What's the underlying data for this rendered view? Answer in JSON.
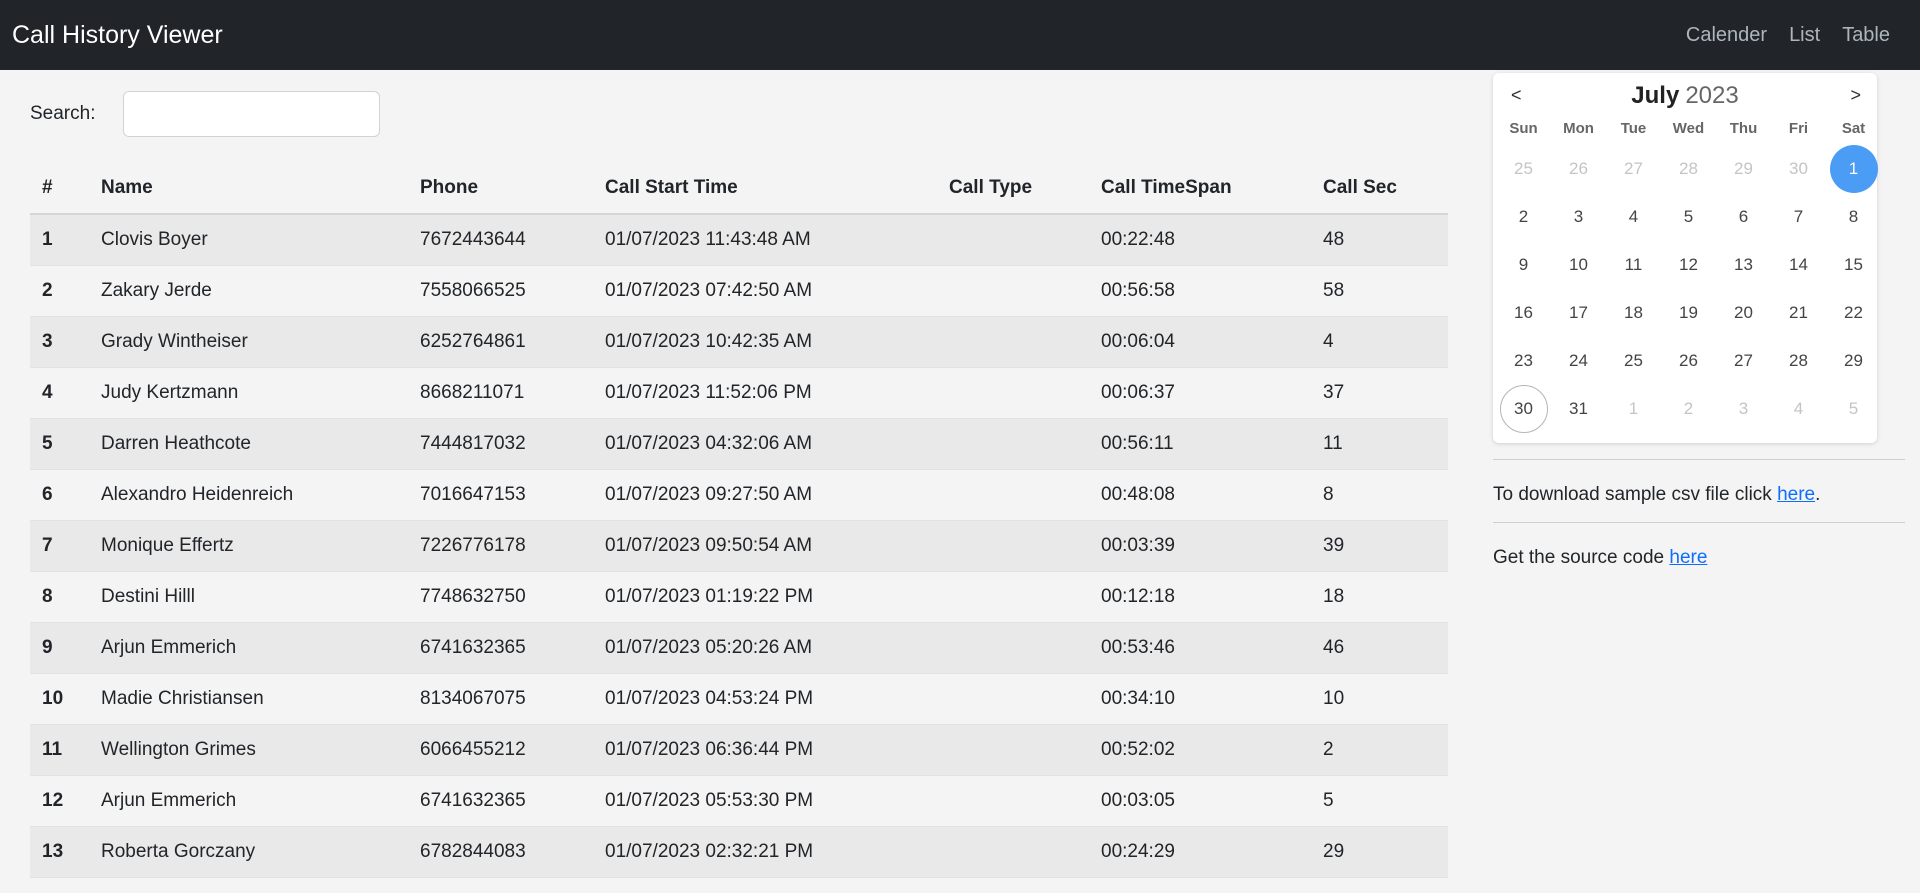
{
  "app": {
    "title": "Call History Viewer"
  },
  "nav": {
    "links": [
      "Calender",
      "List",
      "Table"
    ]
  },
  "search": {
    "label": "Search:",
    "value": ""
  },
  "table": {
    "headers": [
      "#",
      "Name",
      "Phone",
      "Call Start Time",
      "Call Type",
      "Call TimeSpan",
      "Call Sec"
    ],
    "rows": [
      [
        "1",
        "Clovis Boyer",
        "7672443644",
        "01/07/2023 11:43:48 AM",
        "",
        "00:22:48",
        "48"
      ],
      [
        "2",
        "Zakary Jerde",
        "7558066525",
        "01/07/2023 07:42:50 AM",
        "",
        "00:56:58",
        "58"
      ],
      [
        "3",
        "Grady Wintheiser",
        "6252764861",
        "01/07/2023 10:42:35 AM",
        "",
        "00:06:04",
        "4"
      ],
      [
        "4",
        "Judy Kertzmann",
        "8668211071",
        "01/07/2023 11:52:06 PM",
        "",
        "00:06:37",
        "37"
      ],
      [
        "5",
        "Darren Heathcote",
        "7444817032",
        "01/07/2023 04:32:06 AM",
        "",
        "00:56:11",
        "11"
      ],
      [
        "6",
        "Alexandro Heidenreich",
        "7016647153",
        "01/07/2023 09:27:50 AM",
        "",
        "00:48:08",
        "8"
      ],
      [
        "7",
        "Monique Effertz",
        "7226776178",
        "01/07/2023 09:50:54 AM",
        "",
        "00:03:39",
        "39"
      ],
      [
        "8",
        "Destini Hilll",
        "7748632750",
        "01/07/2023 01:19:22 PM",
        "",
        "00:12:18",
        "18"
      ],
      [
        "9",
        "Arjun Emmerich",
        "6741632365",
        "01/07/2023 05:20:26 AM",
        "",
        "00:53:46",
        "46"
      ],
      [
        "10",
        "Madie Christiansen",
        "8134067075",
        "01/07/2023 04:53:24 PM",
        "",
        "00:34:10",
        "10"
      ],
      [
        "11",
        "Wellington Grimes",
        "6066455212",
        "01/07/2023 06:36:44 PM",
        "",
        "00:52:02",
        "2"
      ],
      [
        "12",
        "Arjun Emmerich",
        "6741632365",
        "01/07/2023 05:53:30 PM",
        "",
        "00:03:05",
        "5"
      ],
      [
        "13",
        "Roberta Gorczany",
        "6782844083",
        "01/07/2023 02:32:21 PM",
        "",
        "00:24:29",
        "29"
      ]
    ]
  },
  "calendar": {
    "prev": "<",
    "next": ">",
    "month": "July",
    "year": "2023",
    "weekdays": [
      "Sun",
      "Mon",
      "Tue",
      "Wed",
      "Thu",
      "Fri",
      "Sat"
    ],
    "days": [
      {
        "label": "25",
        "muted": true
      },
      {
        "label": "26",
        "muted": true
      },
      {
        "label": "27",
        "muted": true
      },
      {
        "label": "28",
        "muted": true
      },
      {
        "label": "29",
        "muted": true
      },
      {
        "label": "30",
        "muted": true
      },
      {
        "label": "1",
        "selected": true
      },
      {
        "label": "2"
      },
      {
        "label": "3"
      },
      {
        "label": "4"
      },
      {
        "label": "5"
      },
      {
        "label": "6"
      },
      {
        "label": "7"
      },
      {
        "label": "8"
      },
      {
        "label": "9"
      },
      {
        "label": "10"
      },
      {
        "label": "11"
      },
      {
        "label": "12"
      },
      {
        "label": "13"
      },
      {
        "label": "14"
      },
      {
        "label": "15"
      },
      {
        "label": "16"
      },
      {
        "label": "17"
      },
      {
        "label": "18"
      },
      {
        "label": "19"
      },
      {
        "label": "20"
      },
      {
        "label": "21"
      },
      {
        "label": "22"
      },
      {
        "label": "23"
      },
      {
        "label": "24"
      },
      {
        "label": "25"
      },
      {
        "label": "26"
      },
      {
        "label": "27"
      },
      {
        "label": "28"
      },
      {
        "label": "29"
      },
      {
        "label": "30",
        "today": true
      },
      {
        "label": "31"
      },
      {
        "label": "1",
        "muted": true
      },
      {
        "label": "2",
        "muted": true
      },
      {
        "label": "3",
        "muted": true
      },
      {
        "label": "4",
        "muted": true
      },
      {
        "label": "5",
        "muted": true
      }
    ]
  },
  "sidebar": {
    "download_text": "To download sample csv file click ",
    "download_link": "here",
    "download_suffix": ".",
    "source_text": "Get the source code ",
    "source_link": "here"
  },
  "colors": {
    "navbar": "#212529",
    "selected_day": "#4a9cf5",
    "link": "#0d6efd"
  }
}
